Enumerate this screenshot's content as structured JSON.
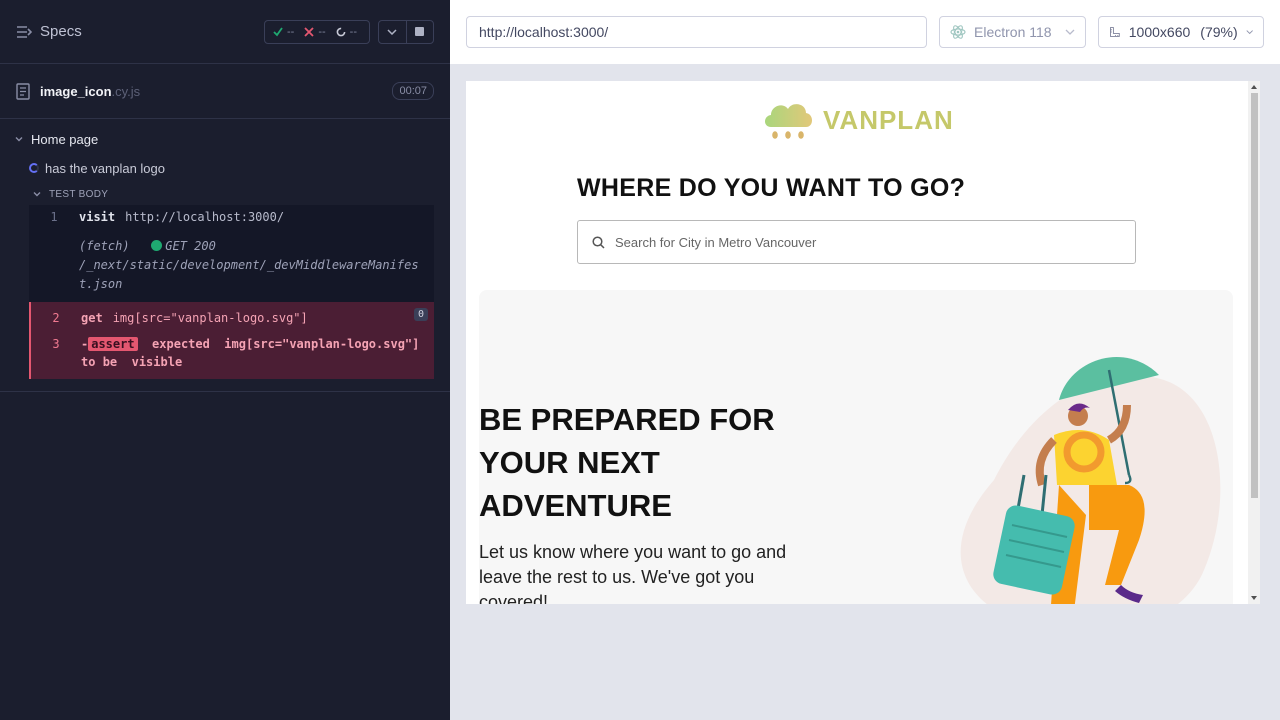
{
  "runner": {
    "header": {
      "title": "Specs",
      "passed": "--",
      "failed": "--",
      "pending": "--"
    },
    "file": {
      "name": "image_icon",
      "ext": ".cy.js",
      "duration": "00:07"
    },
    "suite": {
      "title": "Home page",
      "test_title": "has the vanplan logo",
      "test_body_label": "TEST BODY"
    },
    "commands": [
      {
        "num": "1",
        "name": "visit",
        "arg": "http://localhost:3000/"
      },
      {
        "num": "2",
        "name": "get",
        "arg": "img[src=\"vanplan-logo.svg\"]",
        "count": "0"
      },
      {
        "num": "3",
        "prefix": "-",
        "name": "assert",
        "text_expected": "expected",
        "arg": "img[src=\"vanplan-logo.svg\"]",
        "text_to": "to",
        "text_be": "be",
        "text_visible": "visible"
      }
    ],
    "fetch": {
      "label": "(fetch)",
      "method_status": "GET 200",
      "path": "/_next/static/development/_devMiddlewareManifest.json",
      "status_color": "#1fa971"
    }
  },
  "aut": {
    "url": "http://localhost:3000/",
    "browser": "Electron 118",
    "viewport": "1000x660",
    "zoom": "(79%)"
  },
  "site": {
    "logo_text": "VANPLAN",
    "question": "WHERE DO YOU WANT TO GO?",
    "search_placeholder": "Search for City in Metro Vancouver",
    "hero_title": "BE PREPARED FOR YOUR NEXT ADVENTURE",
    "hero_sub": "Let us know where you want to go and leave the rest to us. We've got you covered!"
  },
  "colors": {
    "runner_bg": "#1b1e2e",
    "error_bg": "#4b1e34",
    "error_accent": "#e45770",
    "logo_color": "#c5c86a"
  }
}
